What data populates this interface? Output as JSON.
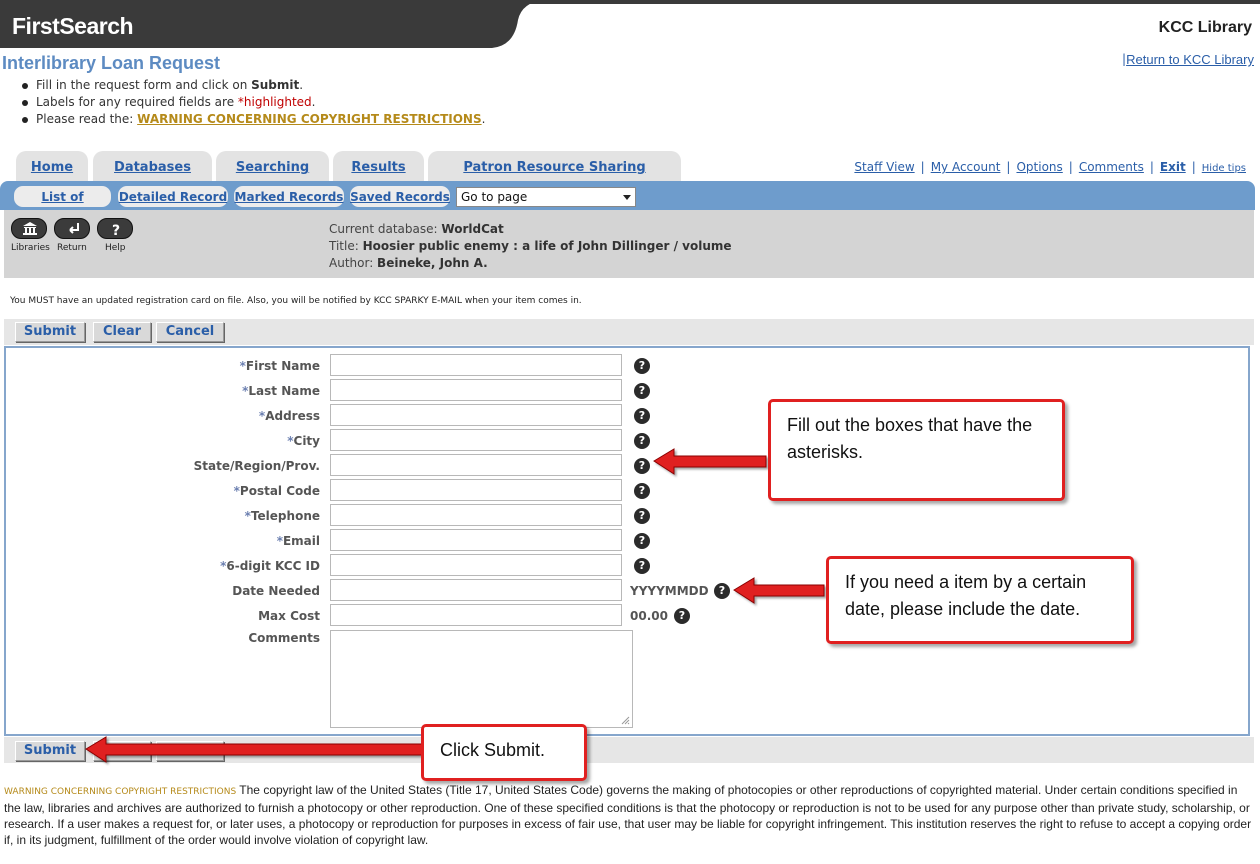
{
  "header": {
    "brand": "FirstSearch",
    "library": "KCC Library",
    "return_link": "Return to KCC Library"
  },
  "page": {
    "title": "Interlibrary Loan Request",
    "instr1_pre": "Fill in the request form and click on ",
    "instr1_bold": "Submit",
    "instr1_post": ".",
    "instr2_pre": "Labels for any required fields are ",
    "instr2_hl": "*highlighted",
    "instr2_post": ".",
    "instr3_pre": "Please read the: ",
    "instr3_link": "WARNING CONCERNING COPYRIGHT RESTRICTIONS",
    "instr3_post": "."
  },
  "tabs": [
    "Home",
    "Databases",
    "Searching",
    "Results",
    "Patron Resource Sharing"
  ],
  "top_links": {
    "staff_view": "Staff View",
    "my_account": "My Account",
    "options": "Options",
    "comments": "Comments",
    "exit": "Exit",
    "hide_tips": "Hide tips"
  },
  "subtabs": [
    "List of Records",
    "Detailed Record",
    "Marked Records",
    "Saved Records"
  ],
  "goto_select": "Go to page",
  "tools": {
    "libraries": "Libraries",
    "return": "Return",
    "help": "Help"
  },
  "record": {
    "db_label": "Current database: ",
    "db_value": "WorldCat",
    "title_label": "Title: ",
    "title_value": "Hoosier public enemy : a life of John Dillinger / volume",
    "author_label": "Author: ",
    "author_value": "Beineke, John A."
  },
  "notice": "You MUST have an updated registration card on file. Also, you will be notified by KCC SPARKY E-MAIL when your item comes in.",
  "buttons": {
    "submit": "Submit",
    "clear": "Clear",
    "cancel": "Cancel"
  },
  "form": {
    "first_name": "First Name",
    "last_name": "Last Name",
    "address": "Address",
    "city": "City",
    "state": "State/Region/Prov.",
    "postal": "Postal Code",
    "telephone": "Telephone",
    "email": "Email",
    "kcc_id": "6-digit KCC ID",
    "date_needed": "Date Needed",
    "date_hint": "YYYYMMDD",
    "max_cost": "Max Cost",
    "cost_hint": "00.00",
    "comments": "Comments",
    "required_mark": "*",
    "help_glyph": "?"
  },
  "callouts": {
    "fill": "Fill out the boxes that have the asterisks.",
    "date": "If you need a item by a certain date, please include the date.",
    "submit": "Click Submit."
  },
  "copyright": {
    "tag": "WARNING CONCERNING COPYRIGHT RESTRICTIONS",
    "text": " The copyright law of the United States (Title 17, United States Code) governs the making of photocopies or other reproductions of copyrighted material. Under certain conditions specified in the law, libraries and archives are authorized to furnish a photocopy or other reproduction. One of these specified conditions is that the photocopy or reproduction is not to be used for any purpose other than private study, scholarship, or research. If a user makes a request for, or later uses, a photocopy or reproduction for purposes in excess of fair use, that user may be liable for copyright infringement. This institution reserves the right to refuse to accept a copying order if, in its judgment, fulfillment of the order would involve violation of copyright law."
  }
}
